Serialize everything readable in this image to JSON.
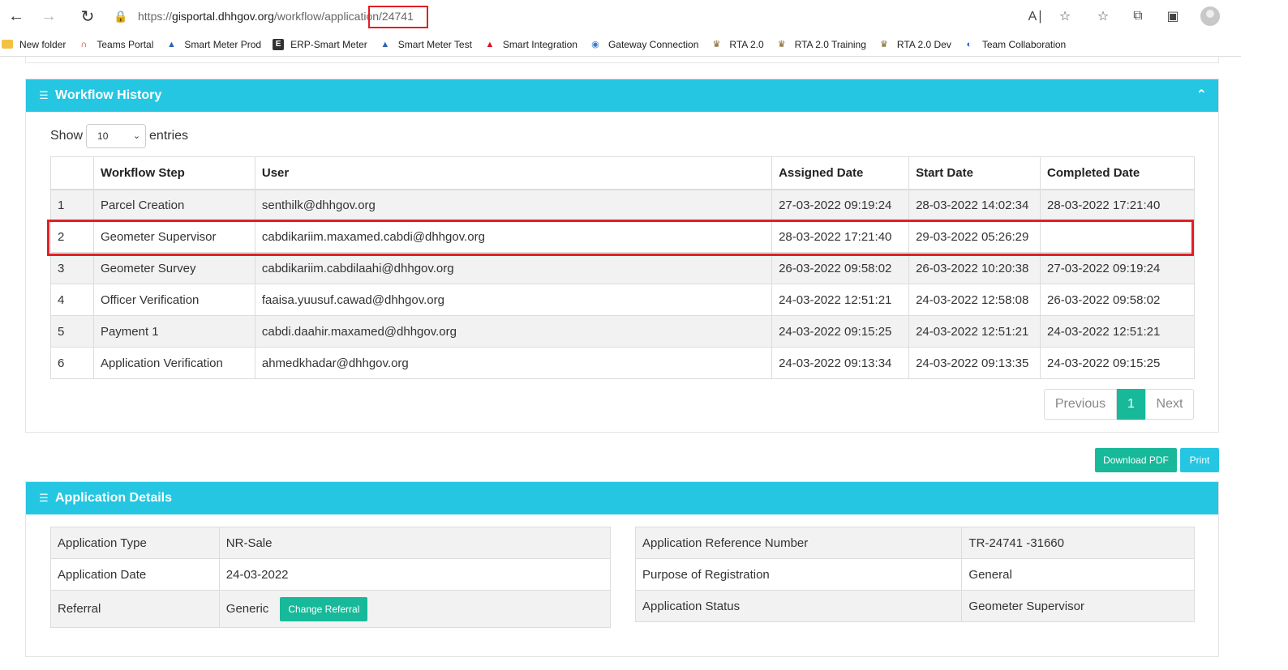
{
  "browser": {
    "url_prefix": "https://",
    "url_host": "gisportal.dhhgov.org",
    "url_path": "/workflow/application/24741",
    "bookmarks": [
      {
        "label": "New folder",
        "icon": "folder-icon"
      },
      {
        "label": "Teams Portal",
        "icon": "teams-portal-icon"
      },
      {
        "label": "Smart Meter Prod",
        "icon": "water-drop-icon"
      },
      {
        "label": "ERP-Smart Meter",
        "icon": "erp-e-icon"
      },
      {
        "label": "Smart Meter Test",
        "icon": "water-drop-icon"
      },
      {
        "label": "Smart Integration",
        "icon": "smart-integration-icon"
      },
      {
        "label": "Gateway Connection",
        "icon": "globe-icon"
      },
      {
        "label": "RTA 2.0",
        "icon": "crest-icon"
      },
      {
        "label": "RTA 2.0 Training",
        "icon": "crest-icon"
      },
      {
        "label": "RTA 2.0 Dev",
        "icon": "crest-icon"
      },
      {
        "label": "Team Collaboration",
        "icon": "collaboration-icon"
      }
    ]
  },
  "workflow": {
    "title": "Workflow History",
    "show_label": "Show",
    "entries_label": "entries",
    "page_size": "10",
    "columns": [
      "",
      "Workflow Step",
      "User",
      "Assigned Date",
      "Start Date",
      "Completed Date"
    ],
    "rows": [
      [
        "1",
        "Parcel Creation",
        "senthilk@dhhgov.org",
        "27-03-2022 09:19:24",
        "28-03-2022 14:02:34",
        "28-03-2022 17:21:40"
      ],
      [
        "2",
        "Geometer Supervisor",
        "cabdikariim.maxamed.cabdi@dhhgov.org",
        "28-03-2022 17:21:40",
        "29-03-2022 05:26:29",
        ""
      ],
      [
        "3",
        "Geometer Survey",
        "cabdikariim.cabdilaahi@dhhgov.org",
        "26-03-2022 09:58:02",
        "26-03-2022 10:20:38",
        "27-03-2022 09:19:24"
      ],
      [
        "4",
        "Officer Verification",
        "faaisa.yuusuf.cawad@dhhgov.org",
        "24-03-2022 12:51:21",
        "24-03-2022 12:58:08",
        "26-03-2022 09:58:02"
      ],
      [
        "5",
        "Payment 1",
        "cabdi.daahir.maxamed@dhhgov.org",
        "24-03-2022 09:15:25",
        "24-03-2022 12:51:21",
        "24-03-2022 12:51:21"
      ],
      [
        "6",
        "Application Verification",
        "ahmedkhadar@dhhgov.org",
        "24-03-2022 09:13:34",
        "24-03-2022 09:13:35",
        "24-03-2022 09:15:25"
      ]
    ],
    "pager": {
      "previous": "Previous",
      "current": "1",
      "next": "Next"
    }
  },
  "actions": {
    "download_pdf": "Download PDF",
    "print": "Print"
  },
  "details": {
    "title": "Application Details",
    "left": [
      {
        "label": "Application Type",
        "value": "NR-Sale"
      },
      {
        "label": "Application Date",
        "value": "24-03-2022"
      },
      {
        "label": "Referral",
        "value": "Generic"
      }
    ],
    "change_referral": "Change Referral",
    "right": [
      {
        "label": "Application Reference Number",
        "value": "TR-24741 -31660"
      },
      {
        "label": "Purpose of Registration",
        "value": "General"
      },
      {
        "label": "Application Status",
        "value": "Geometer Supervisor"
      }
    ]
  }
}
